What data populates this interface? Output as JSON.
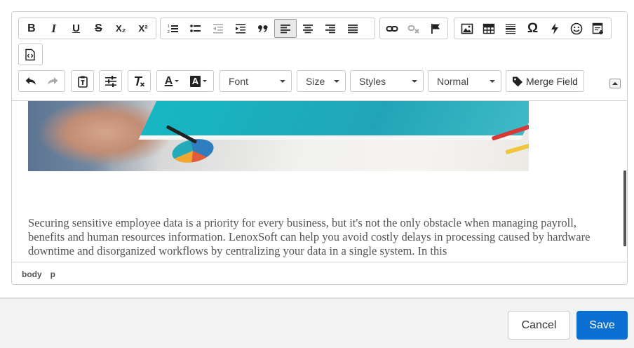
{
  "toolbar": {
    "row1": {
      "basicstyles": [
        {
          "name": "bold-icon",
          "glyph": "B"
        },
        {
          "name": "italic-icon",
          "glyph": "I"
        },
        {
          "name": "underline-icon",
          "glyph": "U"
        },
        {
          "name": "strikethrough-icon",
          "glyph": "S"
        },
        {
          "name": "subscript-icon",
          "glyph": "X₂"
        },
        {
          "name": "superscript-icon",
          "glyph": "X²"
        }
      ],
      "paragraph_icons": [
        "numbered-list-icon",
        "bulleted-list-icon",
        "decrease-indent-icon",
        "increase-indent-icon",
        "blockquote-icon",
        "align-left-icon",
        "align-center-icon",
        "align-right-icon",
        "align-justify-icon"
      ],
      "link_icons": [
        "link-icon",
        "unlink-icon",
        "anchor-flag-icon"
      ],
      "insert_icons": [
        "image-icon",
        "table-icon",
        "horizontal-rule-icon",
        "special-char-icon",
        "flash-icon",
        "smiley-icon",
        "template-icon"
      ],
      "source_icon": "source-icon"
    },
    "row2": {
      "undo_icon": "undo-icon",
      "redo_icon": "redo-icon",
      "paste_icon": "paste-text-icon",
      "format_icon": "sliders-icon",
      "remove_format_icon": "remove-format-icon",
      "text_color_glyph": "A",
      "bg_color_glyph": "A",
      "font": {
        "label": "Font"
      },
      "size": {
        "label": "Size"
      },
      "styles": {
        "label": "Styles"
      },
      "format": {
        "label": "Normal"
      },
      "merge_field": {
        "label": "Merge Field"
      }
    }
  },
  "content": {
    "paragraph": "Securing sensitive employee data is a priority for every business, but it's not the only obstacle when managing payroll, benefits and human resources information. LenoxSoft can help you avoid costly delays in processing caused by hardware downtime and disorganized workflows by centralizing your data in a single system. In this"
  },
  "statusbar": {
    "path": [
      "body",
      "p"
    ]
  },
  "footer": {
    "cancel_label": "Cancel",
    "save_label": "Save"
  },
  "colors": {
    "save_button": "#0b70d1",
    "footer_bg": "#f3f3f3",
    "text": "#555555"
  }
}
